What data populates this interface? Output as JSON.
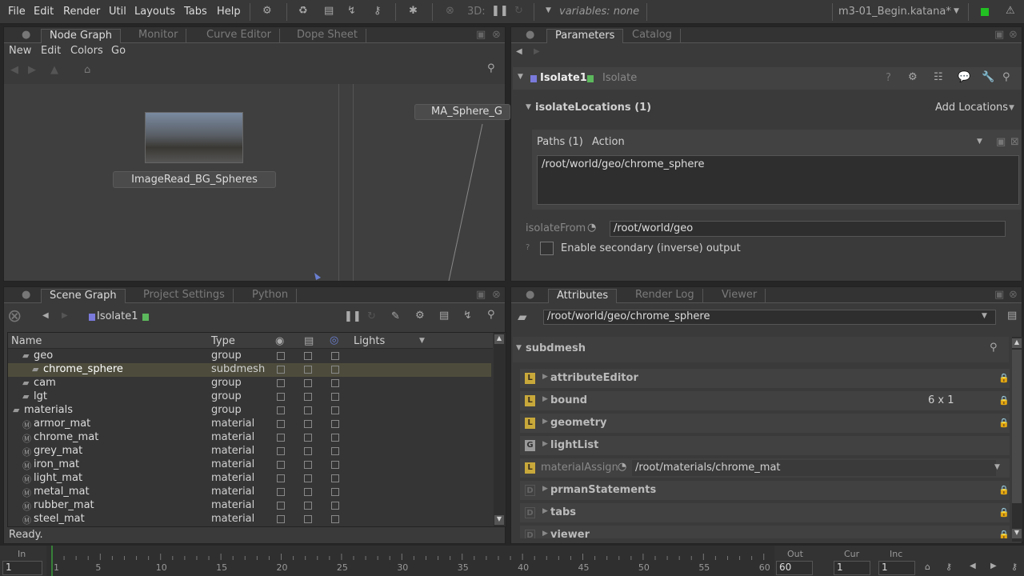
{
  "menubar": {
    "items": [
      "File",
      "Edit",
      "Render",
      "Util",
      "Layouts",
      "Tabs",
      "Help"
    ],
    "three_d_label": "3D:",
    "variables": "variables: none",
    "project": "m3-01_Begin.katana*",
    "status_color": "#22c022"
  },
  "node_graph_panel": {
    "tabs": [
      "Node Graph",
      "Monitor",
      "Curve Editor",
      "Dope Sheet"
    ],
    "menu": [
      "New",
      "Edit",
      "Colors",
      "Go"
    ],
    "nodes": [
      {
        "label": "ImageRead_BG_Spheres"
      },
      {
        "label": "MA_Sphere_G"
      }
    ]
  },
  "parameters_panel": {
    "tabs": [
      "Parameters",
      "Catalog"
    ],
    "node_name": "Isolate1",
    "node_type": "Isolate",
    "group_label": "isolateLocations (1)",
    "add_locations": "Add Locations",
    "paths_header": "Paths (1)",
    "action_header": "Action",
    "path_value": "/root/world/geo/chrome_sphere",
    "isolate_from_label": "isolateFrom",
    "isolate_from_value": "/root/world/geo",
    "secondary_label": "Enable secondary (inverse) output",
    "secondary_checked": false
  },
  "scene_graph_panel": {
    "tabs": [
      "Scene Graph",
      "Project Settings",
      "Python"
    ],
    "node_name": "Isolate1",
    "columns": {
      "name": "Name",
      "type": "Type",
      "lights": "Lights"
    },
    "rows": [
      {
        "name": "geo",
        "type": "group",
        "indent": 1
      },
      {
        "name": "chrome_sphere",
        "type": "subdmesh",
        "indent": 2,
        "selected": true
      },
      {
        "name": "cam",
        "type": "group",
        "indent": 1
      },
      {
        "name": "lgt",
        "type": "group",
        "indent": 1
      },
      {
        "name": "materials",
        "type": "group",
        "indent": 0
      },
      {
        "name": "armor_mat",
        "type": "material",
        "indent": 1
      },
      {
        "name": "chrome_mat",
        "type": "material",
        "indent": 1
      },
      {
        "name": "grey_mat",
        "type": "material",
        "indent": 1
      },
      {
        "name": "iron_mat",
        "type": "material",
        "indent": 1
      },
      {
        "name": "light_mat",
        "type": "material",
        "indent": 1
      },
      {
        "name": "metal_mat",
        "type": "material",
        "indent": 1
      },
      {
        "name": "rubber_mat",
        "type": "material",
        "indent": 1
      },
      {
        "name": "steel_mat",
        "type": "material",
        "indent": 1
      }
    ],
    "status": "Ready."
  },
  "attributes_panel": {
    "tabs": [
      "Attributes",
      "Render Log",
      "Viewer"
    ],
    "location": "/root/world/geo/chrome_sphere",
    "group": "subdmesh",
    "attrs": [
      {
        "badge": "L",
        "name": "attributeEditor",
        "value": ""
      },
      {
        "badge": "L",
        "name": "bound",
        "value": "6 x 1"
      },
      {
        "badge": "L",
        "name": "geometry",
        "value": ""
      },
      {
        "badge": "G",
        "name": "lightList",
        "value": ""
      },
      {
        "badge": "L",
        "name": "materialAssign",
        "value": "/root/materials/chrome_mat"
      },
      {
        "badge": "D",
        "name": "prmanStatements",
        "value": ""
      },
      {
        "badge": "D",
        "name": "tabs",
        "value": ""
      },
      {
        "badge": "D",
        "name": "viewer",
        "value": ""
      }
    ]
  },
  "timeline": {
    "in_label": "In",
    "in_value": "1",
    "out_label": "Out",
    "out_value": "60",
    "cur_label": "Cur",
    "cur_value": "1",
    "inc_label": "Inc",
    "inc_value": "1",
    "ticks": [
      "1",
      "5",
      "10",
      "15",
      "20",
      "25",
      "30",
      "35",
      "40",
      "45",
      "50",
      "55",
      "60"
    ],
    "current_frame": 1
  }
}
